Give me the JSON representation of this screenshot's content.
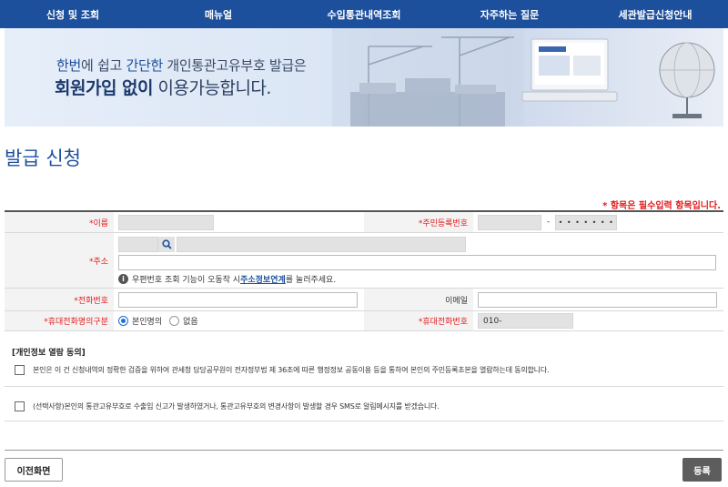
{
  "nav": {
    "items": [
      "신청 및 조회",
      "매뉴얼",
      "수입통관내역조회",
      "자주하는 질문",
      "세관발급신청안내"
    ]
  },
  "banner": {
    "line1_a": "한번",
    "line1_b": "에 쉽고 ",
    "line1_c": "간단한",
    "line1_d": " 개인통관고유부호 발급은",
    "line2_a": "회원가입 없이",
    "line2_b": " 이용가능합니다."
  },
  "page": {
    "title": "발급 신청",
    "required_note": "* 항목은 필수입력 항목입니다."
  },
  "form": {
    "name_label": "*이름",
    "rrn_label": "*주민등록번호",
    "rrn_dash": "-",
    "rrn_back_masked": "• • • • • • •",
    "address_label": "*주소",
    "address_hint_a": "우편번호 조회 기능이 오동작 시 ",
    "address_hint_link": "주소정보연계",
    "address_hint_b": "를 눌러주세요.",
    "phone_label": "*전화번호",
    "email_label": "이메일",
    "mobile_owner_label": "*휴대전화명의구분",
    "mobile_owner_opt1": "본인명의",
    "mobile_owner_opt2": "없음",
    "mobile_label": "*휴대전화번호",
    "mobile_prefix": "010-"
  },
  "consent": {
    "title": "[개인정보 열람 동의]",
    "item1": "본인은 이 건 신청내역의 정확한 검증을 위하여 관세청 담당공무원이 전자정부법 제 36조에 따른 행정정보 공동이용 등을 통하여 본인의 주민등록초본을 열람하는데 동의합니다.",
    "item2": "(선택사항)본인의 통관고유부호로 수출입 신고가 발생하였거나, 통관고유부호의 변경사항이 발생할 경우 SMS로 알림메시지를 받겠습니다."
  },
  "buttons": {
    "prev": "이전화면",
    "submit": "등록"
  },
  "colors": {
    "primary": "#1c4f9c",
    "required": "#e21b1b",
    "submit_bg": "#5d5d5d"
  }
}
